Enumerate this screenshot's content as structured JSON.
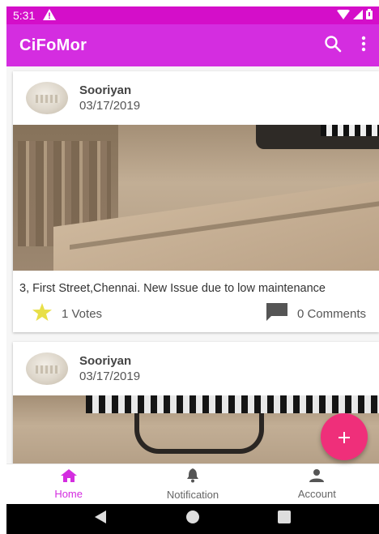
{
  "status_bar": {
    "time": "5:31"
  },
  "app_bar": {
    "title": "CiFoMor"
  },
  "posts": [
    {
      "author": "Sooriyan",
      "date": "03/17/2019",
      "description": "3, First Street,Chennai. New Issue due to low maintenance",
      "votes": "1 Votes",
      "comments": "0 Comments"
    },
    {
      "author": "Sooriyan",
      "date": "03/17/2019"
    }
  ],
  "bottom_nav": {
    "items": [
      {
        "label": "Home",
        "icon": "home-icon",
        "active": true
      },
      {
        "label": "Notification",
        "icon": "bell-icon",
        "active": false
      },
      {
        "label": "Account",
        "icon": "person-icon",
        "active": false
      }
    ]
  },
  "colors": {
    "status_bar": "#d40ec9",
    "app_bar": "#d42de0",
    "fab": "#ef2f7a",
    "star": "#e8df48",
    "active_nav": "#d42de0"
  }
}
